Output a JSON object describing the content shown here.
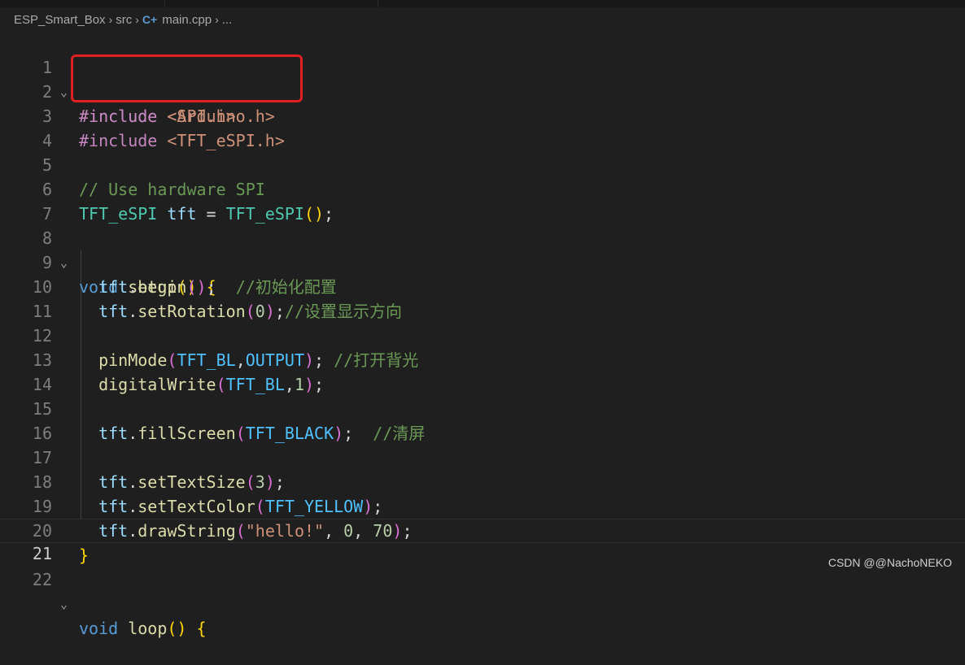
{
  "breadcrumb": {
    "project": "ESP_Smart_Box",
    "folder": "src",
    "file": "main.cpp",
    "more": "...",
    "file_icon": "cpp-file-icon"
  },
  "editor": {
    "line_numbers": [
      "1",
      "2",
      "3",
      "4",
      "5",
      "6",
      "7",
      "8",
      "9",
      "10",
      "11",
      "12",
      "13",
      "14",
      "15",
      "16",
      "17",
      "18",
      "19",
      "20",
      "21",
      "22"
    ],
    "current_line": "21",
    "lines": {
      "l1_include": "#include",
      "l1_header": "<Arduino.h>",
      "l2_include": "#include",
      "l2_header": "<SPI.h>",
      "l3_include": "#include",
      "l3_header": "<TFT_eSPI.h>",
      "l5_comment": "// Use hardware SPI",
      "l6_type": "TFT_eSPI",
      "l6_var": "tft",
      "l6_eq": " = ",
      "l6_ctor": "TFT_eSPI",
      "l8_void": "void",
      "l8_fn": "setup",
      "l9_obj": "tft",
      "l9_fn": "begin",
      "l9_comment": "//初始化配置",
      "l10_obj": "tft",
      "l10_fn": "setRotation",
      "l10_arg": "0",
      "l10_comment": "//设置显示方向",
      "l12_fn": "pinMode",
      "l12_arg1": "TFT_BL",
      "l12_arg2": "OUTPUT",
      "l12_comment": "//打开背光",
      "l13_fn": "digitalWrite",
      "l13_arg1": "TFT_BL",
      "l13_arg2": "1",
      "l15_obj": "tft",
      "l15_fn": "fillScreen",
      "l15_arg": "TFT_BLACK",
      "l15_comment": "//清屏",
      "l17_obj": "tft",
      "l17_fn": "setTextSize",
      "l17_arg": "3",
      "l18_obj": "tft",
      "l18_fn": "setTextColor",
      "l18_arg": "TFT_YELLOW",
      "l19_obj": "tft",
      "l19_fn": "drawString",
      "l19_str": "\"hello!\"",
      "l19_arg2": "0",
      "l19_arg3": "70",
      "l22_void": "void",
      "l22_fn": "loop"
    }
  },
  "annotation_color": "#e02020",
  "watermark": "CSDN @@NachoNEKO"
}
